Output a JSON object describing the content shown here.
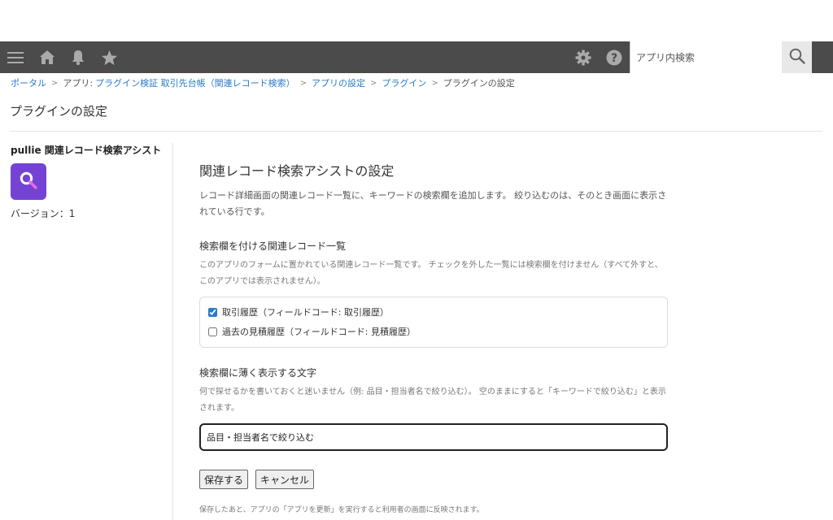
{
  "header": {
    "search_placeholder": "アプリ内検索",
    "icons": [
      "menu-icon",
      "home-icon",
      "bell-icon",
      "star-icon",
      "gear-icon",
      "help-icon",
      "search-icon"
    ],
    "bar_color": "#4b4b4b"
  },
  "breadcrumb": {
    "portal": "ポータル",
    "app_prefix": "アプリ:",
    "app_name": "プラグイン検証 取引先台帳（関連レコード検索）",
    "app_settings": "アプリの設定",
    "plugins": "プラグイン",
    "current": "プラグインの設定",
    "separator": ">"
  },
  "page_title": "プラグインの設定",
  "plugin": {
    "name": "pullie 関連レコード検索アシスト",
    "version": "バージョン：1",
    "logo_color": "#7443d4"
  },
  "settings": {
    "heading": "関連レコード検索アシストの設定",
    "description": "レコード詳細画面の関連レコード一覧に、キーワードの検索欄を追加します。 絞り込むのは、そのとき画面に表示されている行です。",
    "records_section": {
      "title": "検索欄を付ける関連レコード一覧",
      "help": "このアプリのフォームに置かれている関連レコード一覧です。 チェックを外した一覧には検索欄を付けません（すべて外すと、このアプリでは表示されません）。",
      "items": [
        {
          "label": "取引履歴（フィールドコード: 取引履歴）",
          "checked": true
        },
        {
          "label": "過去の見積履歴（フィールドコード: 見積履歴）",
          "checked": false
        }
      ]
    },
    "placeholder_section": {
      "title": "検索欄に薄く表示する文字",
      "help": "何で探せるかを書いておくと迷いません（例: 品目・担当者名で絞り込む）。 空のままにすると「キーワードで絞り込む」と表示されます。",
      "value": "品目・担当者名で絞り込む"
    },
    "save_label": "保存する",
    "cancel_label": "キャンセル",
    "footnote": "保存したあと、アプリの「アプリを更新」を実行すると利用者の画面に反映されます。"
  }
}
